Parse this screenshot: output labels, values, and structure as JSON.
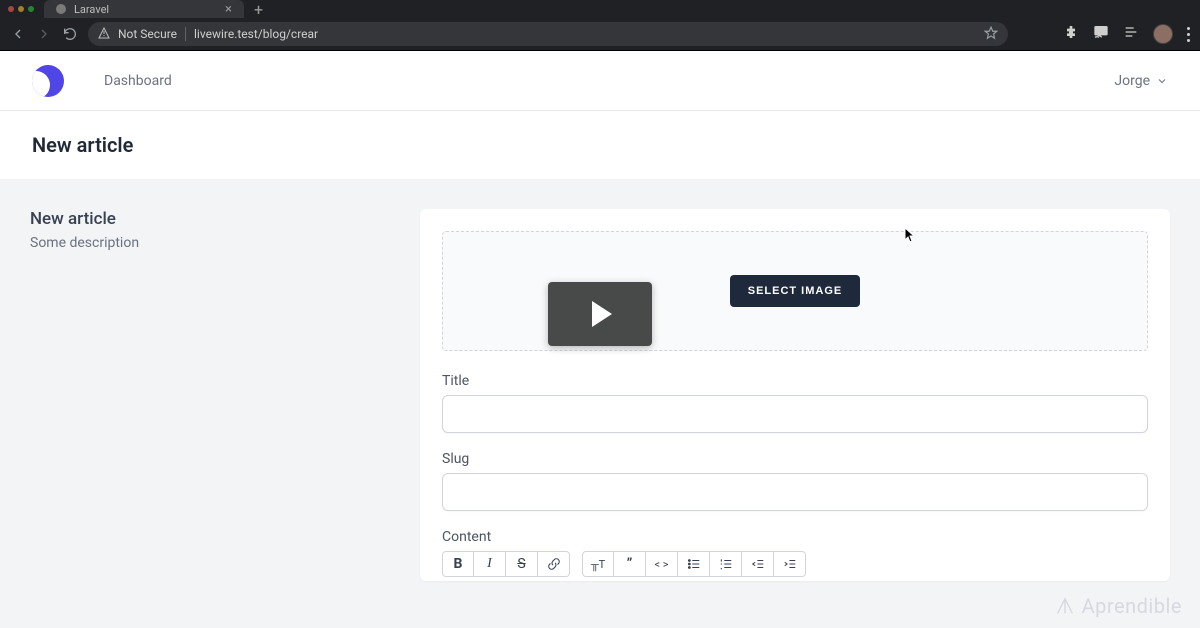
{
  "browser": {
    "tab_title": "Laravel",
    "security_label": "Not Secure",
    "url": "livewire.test/blog/crear"
  },
  "nav": {
    "dashboard": "Dashboard",
    "user_name": "Jorge"
  },
  "page": {
    "title": "New article"
  },
  "section": {
    "heading": "New article",
    "description": "Some description"
  },
  "form": {
    "select_image_label": "SELECT IMAGE",
    "title_label": "Title",
    "title_value": "",
    "slug_label": "Slug",
    "slug_value": "",
    "content_label": "Content"
  },
  "watermark": "Aprendible"
}
